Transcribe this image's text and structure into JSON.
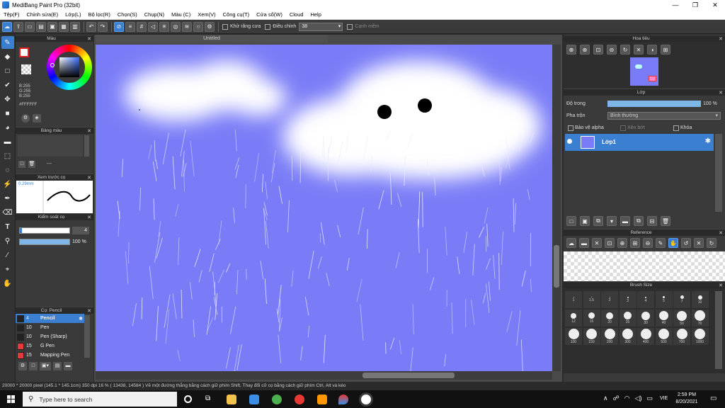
{
  "window": {
    "title": "MediBang Paint Pro (32bit)",
    "min": "—",
    "max": "❐",
    "close": "✕"
  },
  "menu": [
    "Tệp(F)",
    "Chỉnh sửa(E)",
    "Lớp(L)",
    "Bộ lọc(R)",
    "Chọn(S)",
    "Chụp(N)",
    "Màu (C)",
    "Xem(V)",
    "Công cụ(T)",
    "Cửa sổ(W)",
    "Cloud",
    "Help"
  ],
  "toolbar": {
    "antialias_label": "Khử răng cưa",
    "adjust_label": "Điều chỉnh",
    "adjust_value": "38",
    "edge_label": "Cạnh mềm"
  },
  "color_panel": {
    "title": "Màu",
    "b": "B:255",
    "g": "G:255",
    "bb": "B:255",
    "hex": "#FFFFFF",
    "accent": "#3b7fd1"
  },
  "palette_panel": {
    "title": "Bảng màu",
    "dash": "---"
  },
  "preview_panel": {
    "title": "Xem trước cọ",
    "size": "0.29mm"
  },
  "control_panel": {
    "title": "Kiểm soát cọ",
    "size_value": "4",
    "opacity_value": "100 %"
  },
  "brush_panel": {
    "title": "Cọ: Pencil",
    "items": [
      {
        "size": "4",
        "name": "Pencil",
        "color": "#3b7fd1"
      },
      {
        "size": "10",
        "name": "Pen",
        "color": "#222222"
      },
      {
        "size": "10",
        "name": "Pen (Sharp)",
        "color": "#222222"
      },
      {
        "size": "15",
        "name": "G Pen",
        "color": "#e33b3b"
      },
      {
        "size": "15",
        "name": "Mapping Pen",
        "color": "#e33b3b"
      }
    ]
  },
  "document": {
    "tab": "Untitled"
  },
  "navigator": {
    "title": "Hoa tiêu"
  },
  "layer_panel": {
    "title": "Lớp",
    "opacity_label": "Độ trong",
    "opacity_value": "100 %",
    "blend_label": "Pha trộn",
    "blend_value": "Bình thường",
    "protect_alpha": "Bảo vệ alpha",
    "clipping": "Xén bớt",
    "lock": "Khóa",
    "layer_name": "Lớp1"
  },
  "reference_panel": {
    "title": "Reference"
  },
  "brush_size_panel": {
    "title": "Brush Size",
    "sizes": [
      "1",
      "1.5",
      "2",
      "3",
      "4",
      "5",
      "7",
      "10",
      "12",
      "15",
      "20",
      "25",
      "30",
      "40",
      "50",
      "70",
      "100",
      "150",
      "200",
      "300",
      "400",
      "500",
      "700",
      "1000"
    ]
  },
  "status": {
    "text": "20000 * 20000 pixel  (145.1 * 145.1cm)  350 dpi  16 %  ( 13438, 14584 )  Vẽ một đường thẳng bằng cách giữ phím Shift, Thay đổi cỡ cọ bằng cách giữ phím Ctrl, Alt và kéo"
  },
  "taskbar": {
    "search_placeholder": "Type here to search",
    "time": "2:59 PM",
    "date": "8/20/2021",
    "lang": "VIE"
  }
}
